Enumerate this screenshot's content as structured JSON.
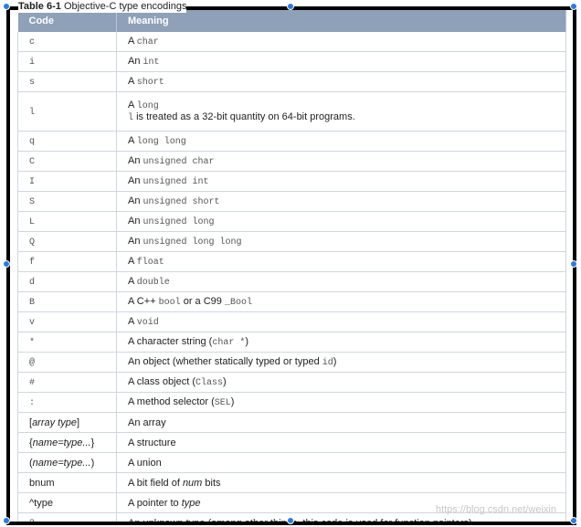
{
  "caption": {
    "title": "Table 6-1",
    "subtitle": "Objective-C type encodings"
  },
  "table": {
    "headers": {
      "code": "Code",
      "meaning": "Meaning"
    },
    "rows": [
      {
        "code": "c",
        "pre": "A ",
        "mono": "char",
        "post": ""
      },
      {
        "code": "i",
        "pre": "An ",
        "mono": "int",
        "post": ""
      },
      {
        "code": "s",
        "pre": "A ",
        "mono": "short",
        "post": ""
      },
      {
        "code": "l",
        "pre": "A ",
        "mono": "long",
        "post": "",
        "line2_mono": "l",
        "line2_text": " is treated as a 32-bit quantity on 64-bit programs."
      },
      {
        "code": "q",
        "pre": "A ",
        "mono": "long long",
        "post": ""
      },
      {
        "code": "C",
        "pre": "An ",
        "mono": "unsigned char",
        "post": ""
      },
      {
        "code": "I",
        "pre": "An ",
        "mono": "unsigned int",
        "post": ""
      },
      {
        "code": "S",
        "pre": "An ",
        "mono": "unsigned short",
        "post": ""
      },
      {
        "code": "L",
        "pre": "An ",
        "mono": "unsigned long",
        "post": ""
      },
      {
        "code": "Q",
        "pre": "An ",
        "mono": "unsigned long long",
        "post": ""
      },
      {
        "code": "f",
        "pre": "A ",
        "mono": "float",
        "post": ""
      },
      {
        "code": "d",
        "pre": "A ",
        "mono": "double",
        "post": ""
      },
      {
        "code": "B",
        "pre": "A C++ ",
        "mono": "bool",
        "post": " or a C99 ",
        "mono2": "_Bool"
      },
      {
        "code": "v",
        "pre": "A ",
        "mono": "void",
        "post": ""
      },
      {
        "code": "*",
        "pre": "A character string (",
        "mono": "char *",
        "post": ")"
      },
      {
        "code": "@",
        "pre": "An object (whether statically typed or typed ",
        "mono": "id",
        "post": ")"
      },
      {
        "code": "#",
        "pre": "A class object (",
        "mono": "Class",
        "post": ")"
      },
      {
        "code": ":",
        "pre": "A method selector (",
        "mono": "SEL",
        "post": ")"
      },
      {
        "code_pre": "[",
        "code_it": "array type",
        "code_post": "]",
        "text": "An array"
      },
      {
        "code_pre": "{",
        "code_it": "name=type...",
        "code_post": "}",
        "text": "A structure"
      },
      {
        "code_pre": "(",
        "code_it": "name=type...",
        "code_post": ")",
        "text": "A union"
      },
      {
        "code_pre": "b",
        "code_it": "",
        "code_post": "num",
        "text_pre": "A bit field of ",
        "text_it": "num",
        "text_post": " bits"
      },
      {
        "code_pre": "^type",
        "code_it": "",
        "code_post": "",
        "text_pre": "A pointer to ",
        "text_it": "type",
        "text_post": ""
      },
      {
        "code": "?",
        "text": "An unknown type (among other things, this code is used for function pointers)"
      }
    ]
  },
  "watermark": "https://blog.csdn.net/weixin",
  "colors": {
    "header_bg": "#8fa0b9",
    "handle": "#2f7bd6",
    "frame": "#000000"
  }
}
